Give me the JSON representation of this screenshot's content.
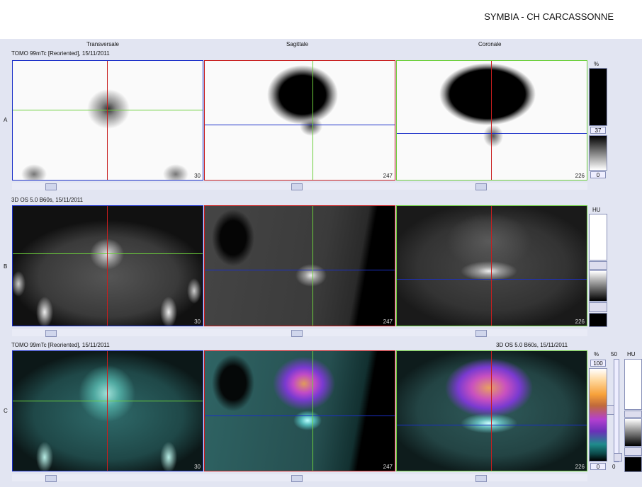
{
  "header": {
    "title": "SYMBIA - CH CARCASSONNE"
  },
  "columns": {
    "col1": "Transversale",
    "col2": "Sagittale",
    "col3": "Coronale"
  },
  "rows": {
    "a": {
      "letter": "A",
      "series": "TOMO 99mTc [Reoriented], 15/11/2011",
      "nums": [
        "30",
        "247",
        "226"
      ],
      "scale": {
        "unit": "%",
        "top": "37",
        "bottom": "0"
      }
    },
    "b": {
      "letter": "B",
      "series": "3D OS 5.0 B60s, 15/11/2011",
      "nums": [
        "30",
        "247",
        "226"
      ],
      "scale": {
        "unit": "HU"
      }
    },
    "c": {
      "letter": "C",
      "series_left": "TOMO 99mTc [Reoriented], 15/11/2011",
      "series_right": "3D OS 5.0 B60s, 15/11/2011",
      "nums": [
        "30",
        "247",
        "226"
      ],
      "scale": {
        "unit": "%",
        "top": "100",
        "bottom": "0",
        "blend_top": "50",
        "blend_bottom": "0",
        "unit2": "HU"
      }
    }
  },
  "colors": {
    "red": "#c81e1e",
    "green": "#6ccf3c",
    "blue": "#1a2fc8",
    "accent": "#8890b8"
  }
}
